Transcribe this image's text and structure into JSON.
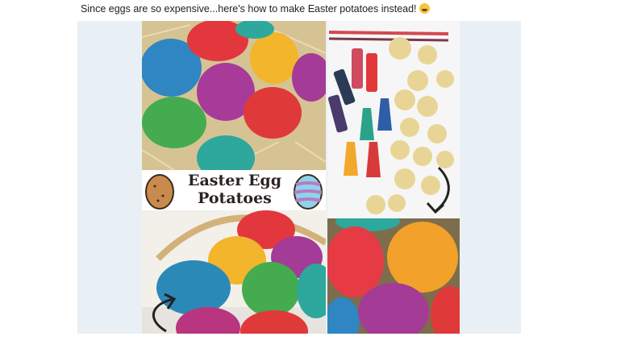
{
  "post": {
    "caption": "Since eggs are so expensive...here's how to make Easter potatoes instead!",
    "emoji": "grinning-sweat-face-emoji"
  },
  "collage": {
    "title_line1": "Easter Egg",
    "title_line2": "Potatoes",
    "colors": {
      "blue": "#2e86c1",
      "red": "#e0383a",
      "yellow": "#f1b52a",
      "purple": "#a8399a",
      "green": "#3fa94b",
      "teal": "#26a59a",
      "pink": "#e7457a",
      "frame": "#e9f0f5"
    }
  }
}
